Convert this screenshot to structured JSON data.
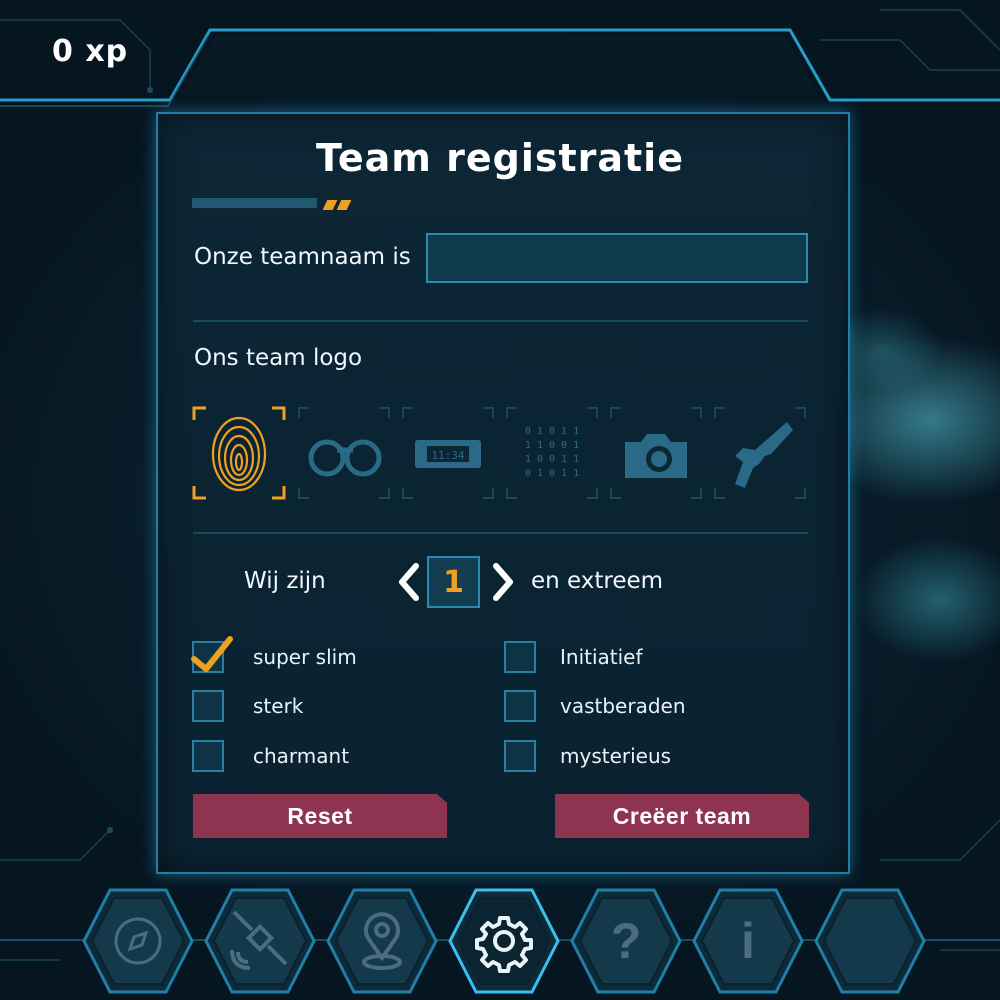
{
  "hud": {
    "xp": "0 xp"
  },
  "panel": {
    "title": "Team registratie",
    "teamname_label": "Onze teamnaam is",
    "teamname_value": "",
    "logo_label": "Ons team logo",
    "logos": [
      {
        "name": "fingerprint-icon",
        "selected": true
      },
      {
        "name": "binoculars-icon",
        "selected": false
      },
      {
        "name": "timer-device-icon",
        "selected": false,
        "text": "11:34"
      },
      {
        "name": "binary-code-icon",
        "selected": false,
        "text": [
          "0 1 0 1 1",
          "1 1 0 0 1",
          "1 0 0 1 1",
          "0 1 0 1 1"
        ]
      },
      {
        "name": "camera-icon",
        "selected": false
      },
      {
        "name": "pistol-icon",
        "selected": false
      }
    ],
    "level": {
      "prefix": "Wij zijn",
      "value": "1",
      "suffix": "en extreem"
    },
    "traits": [
      {
        "label": "super slim",
        "checked": true
      },
      {
        "label": "Initiatief",
        "checked": false
      },
      {
        "label": "sterk",
        "checked": false
      },
      {
        "label": "vastberaden",
        "checked": false
      },
      {
        "label": "charmant",
        "checked": false
      },
      {
        "label": "mysterieus",
        "checked": false
      }
    ],
    "reset_label": "Reset",
    "create_label": "Creëer team"
  },
  "nav": [
    {
      "name": "compass-icon",
      "active": false
    },
    {
      "name": "satellite-icon",
      "active": false
    },
    {
      "name": "map-pin-icon",
      "active": false
    },
    {
      "name": "gear-icon",
      "active": true
    },
    {
      "name": "question-icon",
      "active": false,
      "glyph": "?"
    },
    {
      "name": "info-icon",
      "active": false,
      "glyph": "i"
    },
    {
      "name": "empty-slot",
      "active": false
    }
  ],
  "colors": {
    "accent_orange": "#f0a020",
    "frame_blue": "#1e7fa6",
    "button_red": "#8e3450",
    "background": "#0a2230"
  }
}
